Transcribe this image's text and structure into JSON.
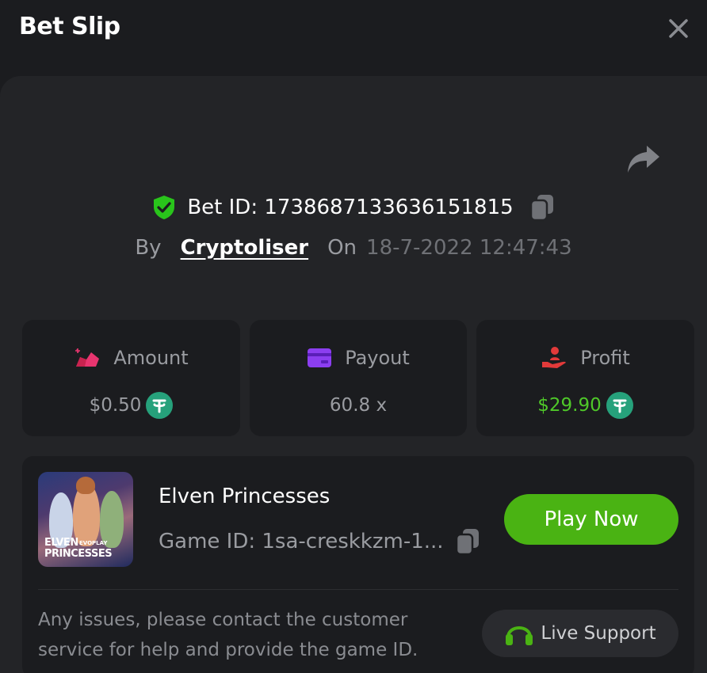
{
  "header": {
    "title": "Bet Slip"
  },
  "bet": {
    "id_label": "Bet ID: 1738687133636151815",
    "by_label": "By",
    "user": "Cryptoliser",
    "on_label": "On",
    "date": "18-7-2022 12:47:43"
  },
  "stats": {
    "amount": {
      "label": "Amount",
      "value": "$0.50"
    },
    "payout": {
      "label": "Payout",
      "value": "60.8 x"
    },
    "profit": {
      "label": "Profit",
      "value": "$29.90"
    }
  },
  "game": {
    "name": "Elven Princesses",
    "id_label": "Game ID: 1sa-creskkzm-1...",
    "thumb_line1": "ELVEN",
    "thumb_brand": "EVOPLAY",
    "thumb_line2": "PRINCESSES",
    "play_label": "Play Now"
  },
  "support": {
    "help_text": "Any issues, please contact the customer service for help and provide the game ID.",
    "live_label": "Live Support"
  },
  "colors": {
    "accent_green": "#4ab313",
    "profit_green": "#4fc829",
    "tether": "#26a17b",
    "amount_pink": "#e8356f",
    "payout_purple": "#8c3ef0",
    "profit_red": "#e23a3a"
  },
  "icons": {
    "close": "close-icon",
    "share": "share-icon",
    "shield": "shield-check-icon",
    "copy": "copy-icon",
    "amount": "chips-icon",
    "payout": "card-icon",
    "profit": "hand-user-icon",
    "coin": "tether-icon",
    "headset": "headset-icon"
  }
}
